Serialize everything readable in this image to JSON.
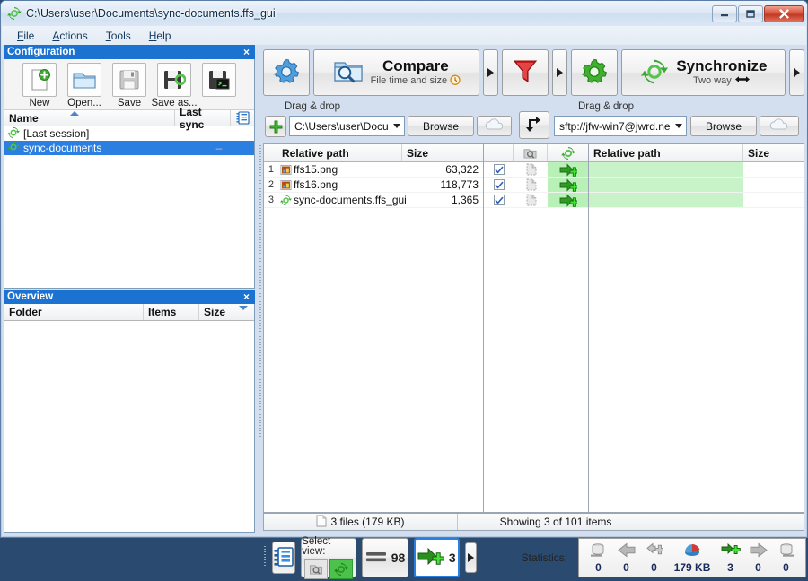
{
  "window": {
    "title": "C:\\Users\\user\\Documents\\sync-documents.ffs_gui",
    "minimize_label": "Minimize",
    "maximize_label": "Maximize",
    "close_label": "Close"
  },
  "menubar": {
    "items": [
      {
        "label": "File",
        "accel": "F"
      },
      {
        "label": "Actions",
        "accel": "A"
      },
      {
        "label": "Tools",
        "accel": "T"
      },
      {
        "label": "Help",
        "accel": "H"
      }
    ]
  },
  "configuration_panel": {
    "caption": "Configuration",
    "close_label": "×",
    "buttons": [
      {
        "label": "New",
        "icon": "new-config-icon"
      },
      {
        "label": "Open...",
        "icon": "open-config-icon"
      },
      {
        "label": "Save",
        "icon": "save-config-icon"
      },
      {
        "label": "Save as...",
        "icon": "save-as-config-icon"
      },
      {
        "label": "",
        "icon": "save-as-batch-icon"
      }
    ],
    "columns": [
      {
        "label": "Name",
        "sort": "asc"
      },
      {
        "label": "Last sync",
        "sort": ""
      }
    ],
    "grid_settings_icon": "grid-settings-icon",
    "rows": [
      {
        "name": "[Last session]",
        "last_sync": "",
        "selected": false,
        "icon": "sync-icon"
      },
      {
        "name": "sync-documents",
        "last_sync": "–",
        "selected": true,
        "icon": "sync-icon"
      }
    ]
  },
  "overview_panel": {
    "caption": "Overview",
    "close_label": "×",
    "columns": [
      {
        "label": "Folder",
        "sort": ""
      },
      {
        "label": "Items",
        "sort": ""
      },
      {
        "label": "Size",
        "sort": "desc"
      }
    ],
    "rows": []
  },
  "toolbar": {
    "settings_button": {
      "label": "",
      "icon": "blue-gear-icon"
    },
    "compare_button": {
      "title": "Compare",
      "subtitle": "File time and size",
      "icon": "compare-folder-icon",
      "sub_icon": "clock-icon"
    },
    "compare_dropdown": {
      "label": "",
      "icon": "chevron-right-icon"
    },
    "filter_button": {
      "label": "",
      "icon": "filter-funnel-icon"
    },
    "filter_dropdown": {
      "label": "",
      "icon": "chevron-right-icon"
    },
    "sync_settings_button": {
      "label": "",
      "icon": "green-gear-icon"
    },
    "synchronize_button": {
      "title": "Synchronize",
      "subtitle": "Two way",
      "icon": "sync-arrows-icon",
      "sub_icon": "two-way-arrow-icon"
    },
    "sync_dropdown": {
      "label": "",
      "icon": "chevron-right-icon"
    }
  },
  "paths": {
    "left": {
      "drag_drop_label": "Drag & drop",
      "add_button_label": "+",
      "value": "C:\\Users\\user\\Docu",
      "placeholder": "Drag && drop",
      "browse_label": "Browse",
      "cloud_label": "",
      "cloud_icon": "cloud-icon"
    },
    "swap_button": {
      "label": "",
      "icon": "swap-arrows-icon"
    },
    "right": {
      "drag_drop_label": "Drag & drop",
      "value": "sftp://jfw-win7@jwrd.ne",
      "placeholder": "Drag && drop",
      "browse_label": "Browse",
      "cloud_label": "",
      "cloud_icon": "cloud-icon"
    }
  },
  "grid": {
    "left_columns": [
      {
        "label": "Relative path"
      },
      {
        "label": "Size"
      }
    ],
    "middle_columns": [
      {
        "label": "",
        "icon": "select-all-icon"
      },
      {
        "label": "",
        "icon": "category-icon"
      },
      {
        "label": "",
        "icon": "action-sync-icon"
      }
    ],
    "right_columns": [
      {
        "label": "Relative path"
      },
      {
        "label": "Size"
      }
    ],
    "rows": [
      {
        "num": "1",
        "name": "ffs15.png",
        "size": "63,322",
        "icon": "png-file-icon",
        "checked": true,
        "action": "create-right-icon"
      },
      {
        "num": "2",
        "name": "ffs16.png",
        "size": "118,773",
        "icon": "png-file-icon",
        "checked": true,
        "action": "create-right-icon"
      },
      {
        "num": "3",
        "name": "sync-documents.ffs_gui",
        "size": "1,365",
        "icon": "sync-icon",
        "checked": true,
        "action": "create-right-icon"
      }
    ]
  },
  "status_bar": {
    "left_text": "3 files (179 KB)",
    "left_icon": "file-icon",
    "middle_text": "Showing 3 of 101 items",
    "right_text": ""
  },
  "bottom_bar": {
    "view_settings_button": {
      "label": "",
      "icon": "view-settings-icon"
    },
    "select_view": {
      "label": "Select view:",
      "compare_toggle": {
        "icon": "magnifier-view-icon",
        "active": false
      },
      "sync_toggle": {
        "icon": "sync-view-icon",
        "active": true
      }
    },
    "equal_button": {
      "count": "98",
      "icon": "equal-icon"
    },
    "create_button": {
      "count": "3",
      "icon": "create-right-arrow-icon",
      "selected": true
    },
    "more_button": {
      "label": "",
      "icon": "chevron-right-icon"
    },
    "statistics": {
      "label": "Statistics:",
      "items": [
        {
          "icon": "delete-left-icon",
          "value": "0"
        },
        {
          "icon": "update-left-icon",
          "value": "0"
        },
        {
          "icon": "create-left-icon",
          "value": "0"
        },
        {
          "icon": "data-pie-icon",
          "value": "179 KB"
        },
        {
          "icon": "create-right-icon",
          "value": "3"
        },
        {
          "icon": "update-right-icon",
          "value": "0"
        },
        {
          "icon": "delete-right-icon",
          "value": "0"
        }
      ]
    }
  },
  "colors": {
    "accent_blue": "#1b72d0",
    "selection_blue": "#2a7fe0",
    "action_green": "#b8f0b8",
    "path_green": "#c8f2c8",
    "title_text": "#0b2a4a"
  }
}
